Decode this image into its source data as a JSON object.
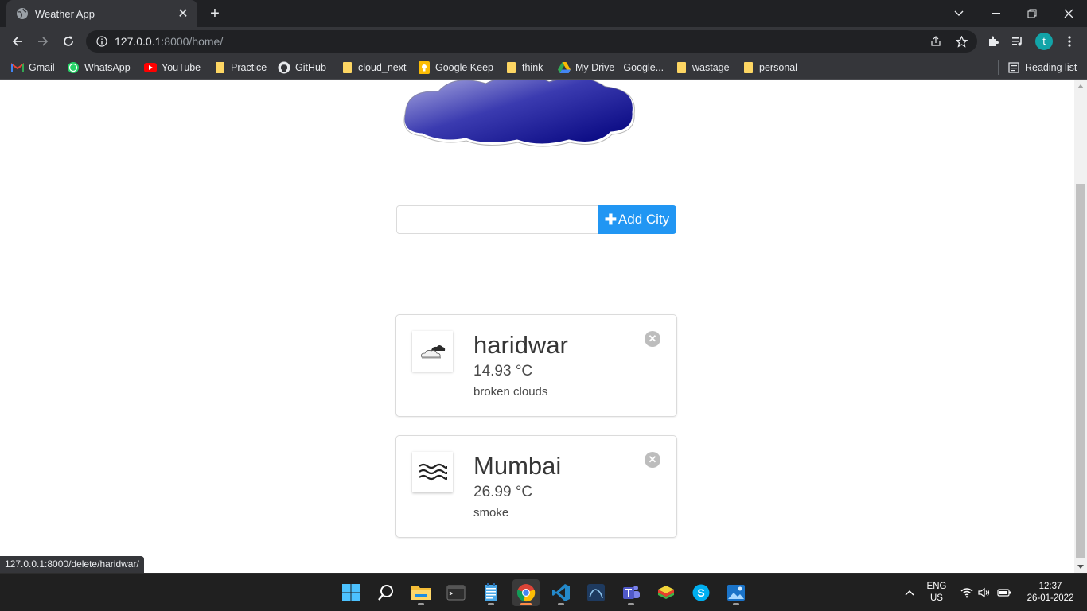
{
  "browser": {
    "tab_title": "Weather App",
    "url_host": "127.0.0.1",
    "url_rest": ":8000/home/",
    "profile_initial": "t",
    "status_url": "127.0.0.1:8000/delete/haridwar/",
    "reading_list": "Reading list"
  },
  "bookmarks": [
    {
      "label": "Gmail",
      "icon": "gmail-icon"
    },
    {
      "label": "WhatsApp",
      "icon": "whatsapp-icon"
    },
    {
      "label": "YouTube",
      "icon": "youtube-icon"
    },
    {
      "label": "Practice",
      "icon": "folder-icon"
    },
    {
      "label": "GitHub",
      "icon": "github-icon"
    },
    {
      "label": "cloud_next",
      "icon": "folder-icon"
    },
    {
      "label": "Google Keep",
      "icon": "google-keep-icon"
    },
    {
      "label": "think",
      "icon": "folder-icon"
    },
    {
      "label": "My Drive - Google...",
      "icon": "google-drive-icon"
    },
    {
      "label": "wastage",
      "icon": "folder-icon"
    },
    {
      "label": "personal",
      "icon": "folder-icon"
    }
  ],
  "app": {
    "city_input_value": "",
    "add_button_label": "Add City",
    "accent": "#2196f3"
  },
  "cities": [
    {
      "name": "haridwar",
      "temp": "14.93 °C",
      "desc": "broken clouds",
      "icon": "broken-clouds-icon"
    },
    {
      "name": "Mumbai",
      "temp": "26.99 °C",
      "desc": "smoke",
      "icon": "smoke-haze-icon"
    }
  ],
  "taskbar": {
    "lang_top": "ENG",
    "lang_bottom": "US",
    "time": "12:37",
    "date": "26-01-2022"
  }
}
